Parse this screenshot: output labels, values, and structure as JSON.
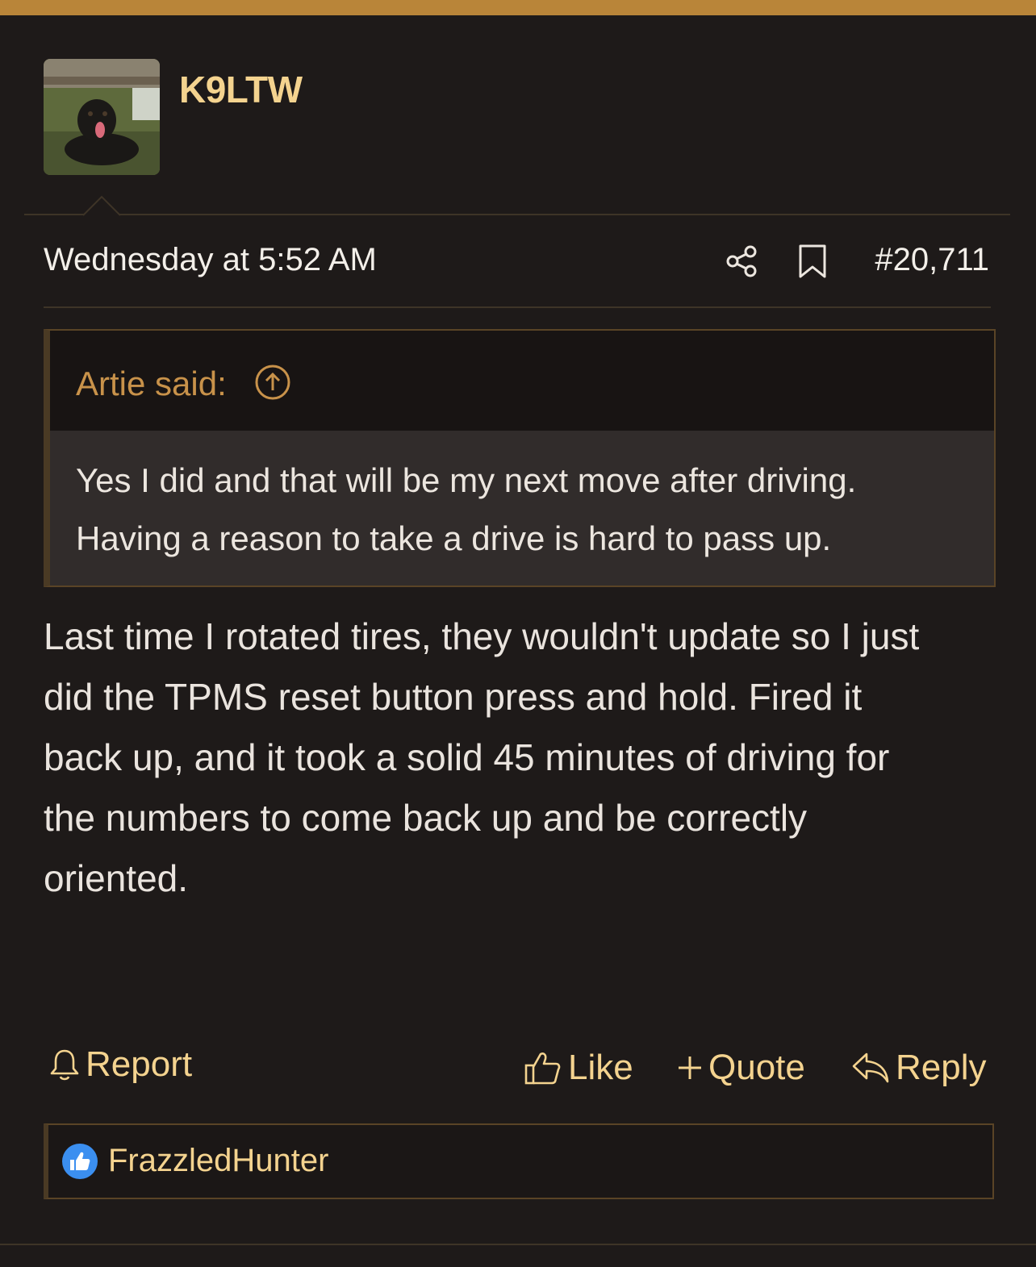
{
  "post": {
    "username": "K9LTW",
    "timestamp": "Wednesday at 5:52 AM",
    "post_number": "#20,711",
    "quote": {
      "attribution": "Artie said:",
      "lines": [
        "Yes I did and that will be my next move after driving.",
        "Having a reason to take a drive is hard to pass up."
      ]
    },
    "message_lines": [
      "Last time I rotated tires, they wouldn't update so I just",
      "did the TPMS reset button press and hold. Fired it",
      "back up, and it took a solid 45 minutes of driving for",
      "the numbers to come back up and be correctly",
      "oriented."
    ],
    "actions": {
      "report": "Report",
      "like": "Like",
      "quote": "Quote",
      "reply": "Reply"
    },
    "reactions": {
      "users": "FrazzledHunter"
    }
  },
  "icons": {
    "avatar": "avatar-dog-photo",
    "share": "share-icon",
    "bookmark": "bookmark-icon",
    "quote_jump": "arrow-up-circle-icon",
    "report": "bell-icon",
    "like": "thumbs-up-icon",
    "quote": "plus-icon",
    "reply": "reply-arrow-icon",
    "reaction": "like-reaction-icon"
  },
  "colors": {
    "background": "#1e1a19",
    "accent_bar": "#b98539",
    "username": "#f4d38f",
    "quote_attribution": "#c8924a",
    "action_text": "#f4d38f",
    "reaction_badge": "#3b8ff0"
  }
}
